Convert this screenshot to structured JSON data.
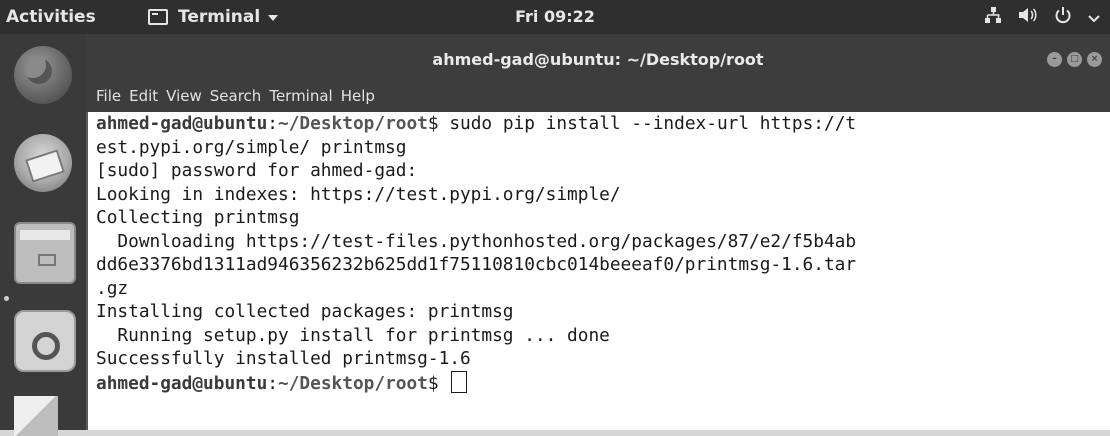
{
  "topbar": {
    "activities": "Activities",
    "app_menu": "Terminal",
    "clock": "Fri 09:22",
    "tray_icons": [
      "network-icon",
      "volume-icon",
      "power-icon",
      "chevron-down-icon"
    ]
  },
  "dock": {
    "items": [
      "firefox-icon",
      "mail-icon",
      "files-icon",
      "software-icon",
      "help-icon"
    ]
  },
  "window": {
    "title": "ahmed-gad@ubuntu: ~/Desktop/root",
    "menu": [
      "File",
      "Edit",
      "View",
      "Search",
      "Terminal",
      "Help"
    ]
  },
  "terminal": {
    "prompt_user": "ahmed-gad@ubuntu",
    "prompt_sep": ":",
    "prompt_path": "~/Desktop/root",
    "prompt_symbol": "$",
    "command_1": " sudo pip install --index-url https://t",
    "line_2": "est.pypi.org/simple/ printmsg",
    "line_3": "[sudo] password for ahmed-gad:",
    "line_4": "Looking in indexes: https://test.pypi.org/simple/",
    "line_5": "Collecting printmsg",
    "line_6": "  Downloading https://test-files.pythonhosted.org/packages/87/e2/f5b4ab",
    "line_7": "dd6e3376bd1311ad946356232b625dd1f75110810cbc014beeeaf0/printmsg-1.6.tar",
    "line_8": ".gz",
    "line_9": "Installing collected packages: printmsg",
    "line_10": "  Running setup.py install for printmsg ... done",
    "line_11": "Successfully installed printmsg-1.6",
    "command_2": " "
  }
}
